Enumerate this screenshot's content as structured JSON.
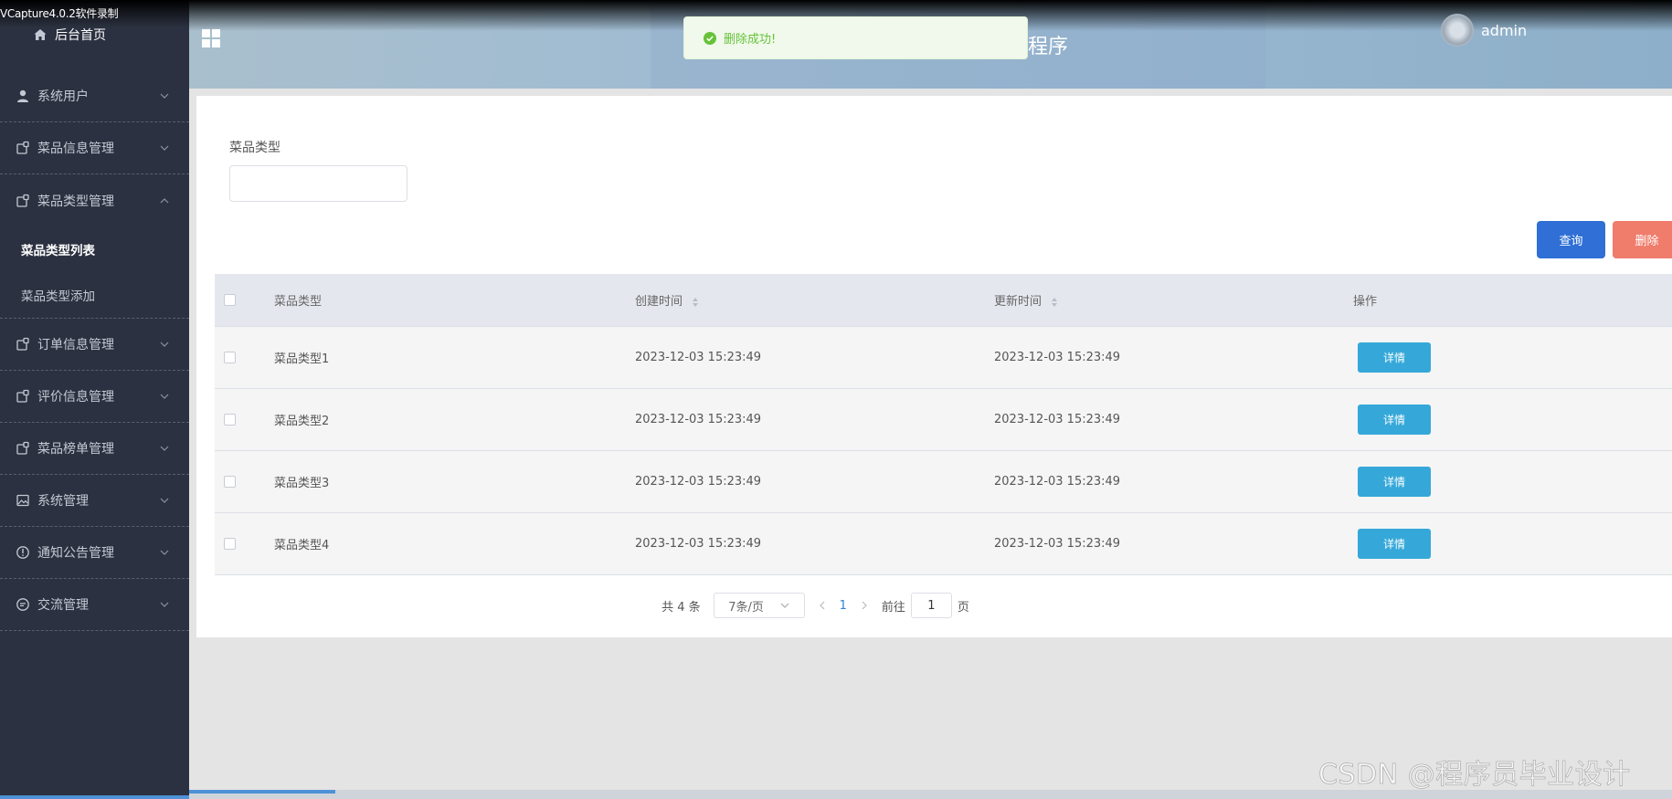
{
  "recorder": {
    "label": "VCapture4.0.2软件录制"
  },
  "sidebar": {
    "home_label": "后台首页",
    "items": [
      {
        "label": "系统用户",
        "icon": "user-icon"
      },
      {
        "label": "菜品信息管理",
        "icon": "document-icon"
      },
      {
        "label": "菜品类型管理",
        "icon": "document-icon",
        "expanded": true,
        "children": [
          {
            "label": "菜品类型列表",
            "active": true
          },
          {
            "label": "菜品类型添加",
            "active": false
          }
        ]
      },
      {
        "label": "订单信息管理",
        "icon": "document-icon"
      },
      {
        "label": "评价信息管理",
        "icon": "document-icon"
      },
      {
        "label": "菜品榜单管理",
        "icon": "document-icon"
      },
      {
        "label": "系统管理",
        "icon": "image-icon"
      },
      {
        "label": "通知公告管理",
        "icon": "info-icon"
      },
      {
        "label": "交流管理",
        "icon": "chat-icon"
      }
    ]
  },
  "header": {
    "title_fragment": "程序",
    "username": "admin"
  },
  "toast": {
    "message": "删除成功!"
  },
  "filter": {
    "label": "菜品类型",
    "value": ""
  },
  "actions": {
    "query": "查询",
    "delete": "删除"
  },
  "table": {
    "headers": {
      "type": "菜品类型",
      "created": "创建时间",
      "updated": "更新时间",
      "operation": "操作"
    },
    "detail_label": "详情",
    "rows": [
      {
        "type": "菜品类型1",
        "created": "2023-12-03 15:23:49",
        "updated": "2023-12-03 15:23:49"
      },
      {
        "type": "菜品类型2",
        "created": "2023-12-03 15:23:49",
        "updated": "2023-12-03 15:23:49"
      },
      {
        "type": "菜品类型3",
        "created": "2023-12-03 15:23:49",
        "updated": "2023-12-03 15:23:49"
      },
      {
        "type": "菜品类型4",
        "created": "2023-12-03 15:23:49",
        "updated": "2023-12-03 15:23:49"
      }
    ]
  },
  "pagination": {
    "total_text": "共 4 条",
    "page_size": "7条/页",
    "current_page": "1",
    "goto_prefix": "前往",
    "goto_value": "1",
    "goto_suffix": "页"
  },
  "watermark": "CSDN @程序员毕业设计",
  "colors": {
    "sidebar_bg": "#2b3140",
    "query_button": "#2f6fd6",
    "delete_button": "#f07c6c",
    "detail_button": "#35a8d9",
    "success": "#67c23a"
  }
}
